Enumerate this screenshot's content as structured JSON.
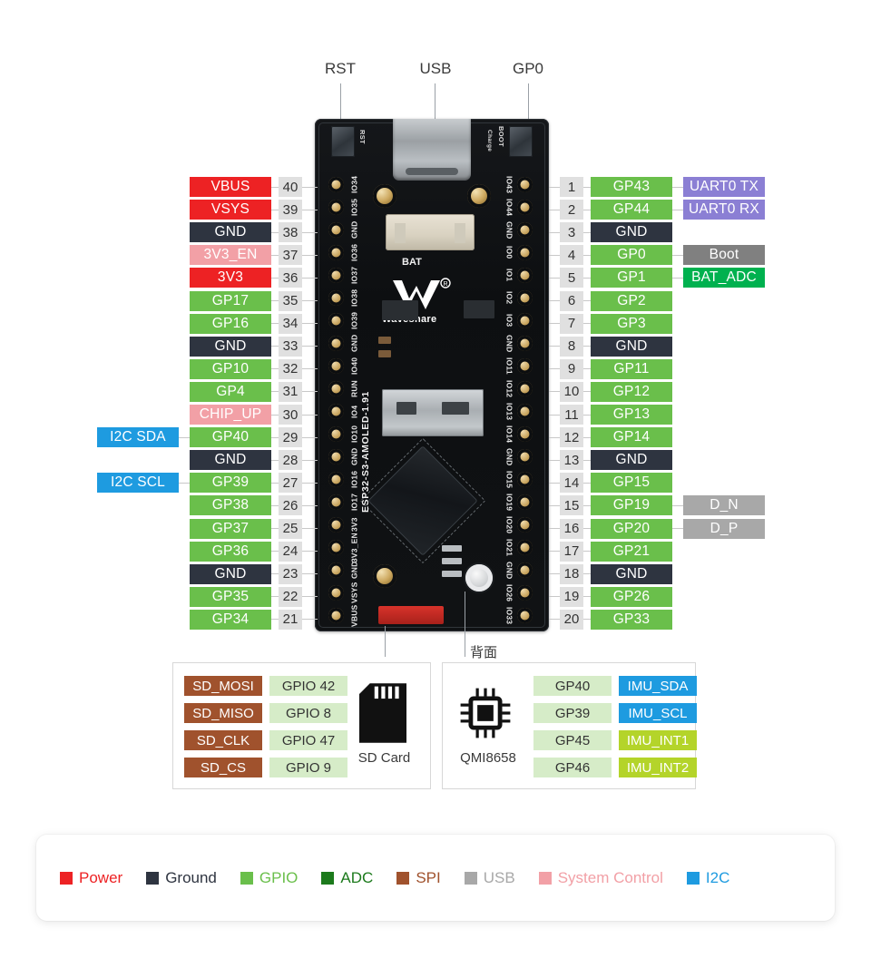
{
  "board": {
    "silkscreen_name": "ESP32-S3-AMOLED-1.91",
    "brand": "Waveshare",
    "bat_label": "BAT",
    "rst_silk": "RST",
    "boot_silk": "BOOT",
    "charge_silk": "Charge",
    "back_note": "背面"
  },
  "callouts": [
    {
      "label": "RST"
    },
    {
      "label": "USB"
    },
    {
      "label": "GP0"
    }
  ],
  "colors": {
    "power": "#ED2224",
    "ground": "#2E3440",
    "gpio": "#6ABF4B",
    "adc": "#1C7A1C",
    "spi": "#A0522D",
    "usb": "#A8A8A8",
    "system_control": "#F2A0A6",
    "i2c": "#1E9BE0",
    "uart": "#8B7FD4",
    "boot": "#808080",
    "bat_adc": "#00B14F",
    "imu_int": "#B4D42A",
    "pin_number_bg": "#E0E0E0",
    "gpio_light": "#D6ECC8"
  },
  "left_pins": [
    {
      "num": "40",
      "name": "VBUS",
      "type": "power",
      "silk": "VBUS",
      "fn": null,
      "fn_type": null
    },
    {
      "num": "39",
      "name": "VSYS",
      "type": "power",
      "silk": "VSYS",
      "fn": null,
      "fn_type": null
    },
    {
      "num": "38",
      "name": "GND",
      "type": "ground",
      "silk": "GND",
      "fn": null,
      "fn_type": null
    },
    {
      "num": "37",
      "name": "3V3_EN",
      "type": "system",
      "silk": "3V3_EN",
      "fn": null,
      "fn_type": null
    },
    {
      "num": "36",
      "name": "3V3",
      "type": "power",
      "silk": "3V3",
      "fn": null,
      "fn_type": null
    },
    {
      "num": "35",
      "name": "GP17",
      "type": "gpio",
      "silk": "IO17",
      "fn": null,
      "fn_type": null
    },
    {
      "num": "34",
      "name": "GP16",
      "type": "gpio",
      "silk": "IO16",
      "fn": null,
      "fn_type": null
    },
    {
      "num": "33",
      "name": "GND",
      "type": "ground",
      "silk": "GND",
      "fn": null,
      "fn_type": null
    },
    {
      "num": "32",
      "name": "GP10",
      "type": "gpio",
      "silk": "IO10",
      "fn": null,
      "fn_type": null
    },
    {
      "num": "31",
      "name": "GP4",
      "type": "gpio",
      "silk": "IO4",
      "fn": null,
      "fn_type": null
    },
    {
      "num": "30",
      "name": "CHIP_UP",
      "type": "system",
      "silk": "RUN",
      "fn": null,
      "fn_type": null
    },
    {
      "num": "29",
      "name": "GP40",
      "type": "gpio",
      "silk": "IO40",
      "fn": "I2C SDA",
      "fn_type": "i2c"
    },
    {
      "num": "28",
      "name": "GND",
      "type": "ground",
      "silk": "GND",
      "fn": null,
      "fn_type": null
    },
    {
      "num": "27",
      "name": "GP39",
      "type": "gpio",
      "silk": "IO39",
      "fn": "I2C SCL",
      "fn_type": "i2c"
    },
    {
      "num": "26",
      "name": "GP38",
      "type": "gpio",
      "silk": "IO38",
      "fn": null,
      "fn_type": null
    },
    {
      "num": "25",
      "name": "GP37",
      "type": "gpio",
      "silk": "IO37",
      "fn": null,
      "fn_type": null
    },
    {
      "num": "24",
      "name": "GP36",
      "type": "gpio",
      "silk": "IO36",
      "fn": null,
      "fn_type": null
    },
    {
      "num": "23",
      "name": "GND",
      "type": "ground",
      "silk": "GND",
      "fn": null,
      "fn_type": null
    },
    {
      "num": "22",
      "name": "GP35",
      "type": "gpio",
      "silk": "IO35",
      "fn": null,
      "fn_type": null
    },
    {
      "num": "21",
      "name": "GP34",
      "type": "gpio",
      "silk": "IO34",
      "fn": null,
      "fn_type": null
    }
  ],
  "right_pins": [
    {
      "num": "1",
      "name": "GP43",
      "type": "gpio",
      "silk": "IO43",
      "fn": "UART0 TX",
      "fn_type": "uart"
    },
    {
      "num": "2",
      "name": "GP44",
      "type": "gpio",
      "silk": "IO44",
      "fn": "UART0 RX",
      "fn_type": "uart"
    },
    {
      "num": "3",
      "name": "GND",
      "type": "ground",
      "silk": "GND",
      "fn": null,
      "fn_type": null
    },
    {
      "num": "4",
      "name": "GP0",
      "type": "gpio",
      "silk": "IO0",
      "fn": "Boot",
      "fn_type": "boot"
    },
    {
      "num": "5",
      "name": "GP1",
      "type": "gpio",
      "silk": "IO1",
      "fn": "BAT_ADC",
      "fn_type": "bat_adc"
    },
    {
      "num": "6",
      "name": "GP2",
      "type": "gpio",
      "silk": "IO2",
      "fn": null,
      "fn_type": null
    },
    {
      "num": "7",
      "name": "GP3",
      "type": "gpio",
      "silk": "IO3",
      "fn": null,
      "fn_type": null
    },
    {
      "num": "8",
      "name": "GND",
      "type": "ground",
      "silk": "GND",
      "fn": null,
      "fn_type": null
    },
    {
      "num": "9",
      "name": "GP11",
      "type": "gpio",
      "silk": "IO11",
      "fn": null,
      "fn_type": null
    },
    {
      "num": "10",
      "name": "GP12",
      "type": "gpio",
      "silk": "IO12",
      "fn": null,
      "fn_type": null
    },
    {
      "num": "11",
      "name": "GP13",
      "type": "gpio",
      "silk": "IO13",
      "fn": null,
      "fn_type": null
    },
    {
      "num": "12",
      "name": "GP14",
      "type": "gpio",
      "silk": "IO14",
      "fn": null,
      "fn_type": null
    },
    {
      "num": "13",
      "name": "GND",
      "type": "ground",
      "silk": "GND",
      "fn": null,
      "fn_type": null
    },
    {
      "num": "14",
      "name": "GP15",
      "type": "gpio",
      "silk": "IO15",
      "fn": null,
      "fn_type": null
    },
    {
      "num": "15",
      "name": "GP19",
      "type": "gpio",
      "silk": "IO19",
      "fn": "D_N",
      "fn_type": "usb"
    },
    {
      "num": "16",
      "name": "GP20",
      "type": "gpio",
      "silk": "IO20",
      "fn": "D_P",
      "fn_type": "usb"
    },
    {
      "num": "17",
      "name": "GP21",
      "type": "gpio",
      "silk": "IO21",
      "fn": null,
      "fn_type": null
    },
    {
      "num": "18",
      "name": "GND",
      "type": "ground",
      "silk": "GND",
      "fn": null,
      "fn_type": null
    },
    {
      "num": "19",
      "name": "GP26",
      "type": "gpio",
      "silk": "IO26",
      "fn": null,
      "fn_type": null
    },
    {
      "num": "20",
      "name": "GP33",
      "type": "gpio",
      "silk": "IO33",
      "fn": null,
      "fn_type": null
    }
  ],
  "sd_panel": {
    "caption": "SD Card",
    "rows": [
      {
        "signal": "SD_MOSI",
        "gpio": "GPIO 42"
      },
      {
        "signal": "SD_MISO",
        "gpio": "GPIO 8"
      },
      {
        "signal": "SD_CLK",
        "gpio": "GPIO 47"
      },
      {
        "signal": "SD_CS",
        "gpio": "GPIO 9"
      }
    ]
  },
  "imu_panel": {
    "caption": "QMI8658",
    "rows": [
      {
        "gpio": "GP40",
        "signal": "IMU_SDA",
        "signal_type": "i2c"
      },
      {
        "gpio": "GP39",
        "signal": "IMU_SCL",
        "signal_type": "i2c"
      },
      {
        "gpio": "GP45",
        "signal": "IMU_INT1",
        "signal_type": "imu_int"
      },
      {
        "gpio": "GP46",
        "signal": "IMU_INT2",
        "signal_type": "imu_int"
      }
    ]
  },
  "legend": [
    {
      "label": "Power",
      "color": "#ED2224"
    },
    {
      "label": "Ground",
      "color": "#2E3440"
    },
    {
      "label": "GPIO",
      "color": "#6ABF4B"
    },
    {
      "label": "ADC",
      "color": "#1C7A1C"
    },
    {
      "label": "SPI",
      "color": "#A0522D"
    },
    {
      "label": "USB",
      "color": "#A8A8A8"
    },
    {
      "label": "System Control",
      "color": "#F2A0A6"
    },
    {
      "label": "I2C",
      "color": "#1E9BE0"
    }
  ]
}
